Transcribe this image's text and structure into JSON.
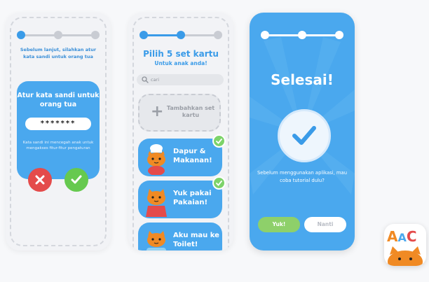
{
  "screen1": {
    "intro": "Sebelum lanjut, silahkan atur kata sandi untuk orang tua",
    "card_title": "Atur kata sandi untuk orang tua",
    "password_value": "*******",
    "note": "Kata sandi ini mencegah anak untuk mengakses fitur-fitur pengaturan",
    "cancel_icon": "close-icon",
    "confirm_icon": "check-icon",
    "progress_step": 1,
    "progress_total": 3
  },
  "screen2": {
    "title": "Pilih 5 set kartu",
    "subtitle": "Untuk anak anda!",
    "search_placeholder": "cari",
    "add_label": "Tambahkan set kartu",
    "sets": [
      {
        "label": "Dapur & Makanan!",
        "checked": true
      },
      {
        "label": "Yuk pakai Pakaian!",
        "checked": true
      },
      {
        "label": "Aku mau ke Toilet!",
        "checked": false
      }
    ],
    "progress_step": 2,
    "progress_total": 3
  },
  "screen3": {
    "title": "Selesai!",
    "message": "Sebelum menggunakan aplikasi, mau coba tutorial dulu?",
    "yes_label": "Yuk!",
    "no_label": "Nanti",
    "progress_step": 3,
    "progress_total": 3
  },
  "app_icon": {
    "letters": [
      "A",
      "A",
      "C"
    ],
    "colors": [
      "#f08a24",
      "#4aa8ee",
      "#e44b4b"
    ]
  },
  "colors": {
    "primary": "#4aa8ee",
    "success": "#66c94f",
    "danger": "#e44b4b"
  }
}
